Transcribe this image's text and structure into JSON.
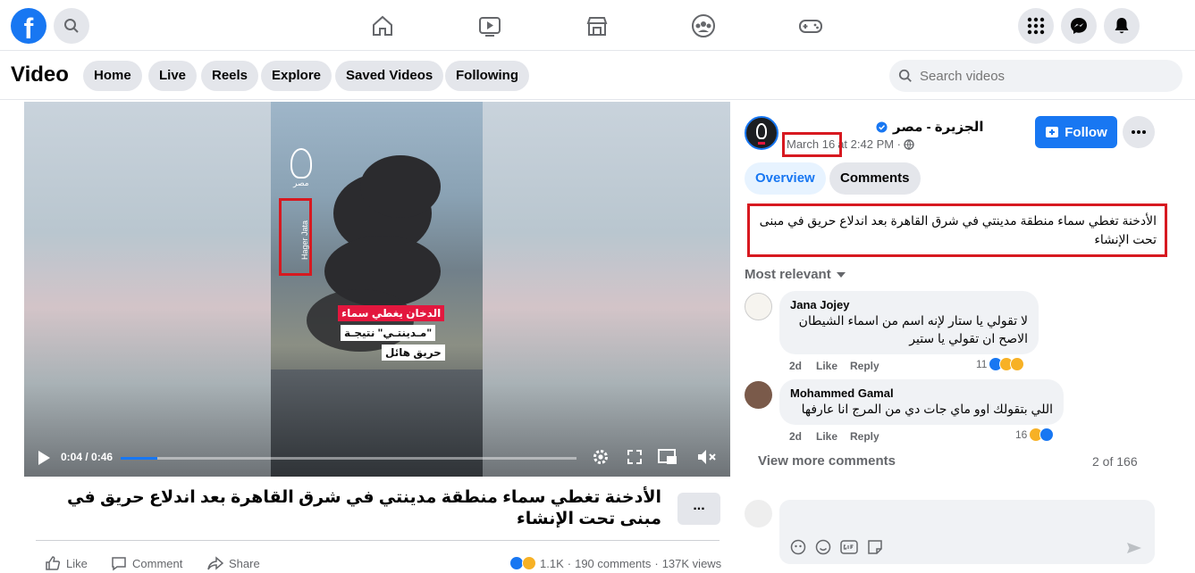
{
  "topbar": {
    "logo": "f",
    "nav_icons": [
      "home-icon",
      "video-icon",
      "marketplace-icon",
      "groups-icon",
      "gaming-icon"
    ],
    "right_icons": [
      "menu-grid-icon",
      "messenger-icon",
      "notifications-icon"
    ]
  },
  "subbar": {
    "title": "Video",
    "tabs": [
      "Home",
      "Live",
      "Reels",
      "Explore",
      "Saved Videos",
      "Following"
    ],
    "search_placeholder": "Search videos"
  },
  "player": {
    "time": "0:04 / 0:46",
    "progress_fraction": 0.08,
    "overlay_captions": [
      "الدخان يغطي سماء",
      "\"مـدينتـي\" نتيجـة",
      "حريق هائل"
    ],
    "watermark": "Hager Jata",
    "channel_mark": "مصر"
  },
  "post": {
    "title": "الأدخنة تغطي سماء منطقة مدينتي في شرق القاهرة بعد اندلاع حريق في مبنى تحت الإنشاء",
    "more": "...",
    "actions": {
      "like": "Like",
      "comment": "Comment",
      "share": "Share"
    },
    "stats": {
      "reactions": "1.1K",
      "comments": "190 comments",
      "views": "137K views"
    }
  },
  "sidebar": {
    "page_name": "الجزيرة - مصر",
    "date": "March 16",
    "time": "at 2:42 PM ·",
    "follow_label": "Follow",
    "tabs": [
      "Overview",
      "Comments"
    ],
    "description": "الأدخنة تغطي سماء منطقة مدينتي في شرق القاهرة بعد اندلاع حريق في مبنى تحت الإنشاء",
    "sort_label": "Most relevant",
    "comments": [
      {
        "name": "Jana Jojey",
        "text": "لا تقولي يا ستار لإنه اسم من اسماء الشيطان الاصح ان تقولي يا ستير",
        "age": "2d",
        "like": "Like",
        "reply": "Reply",
        "reactions": "11"
      },
      {
        "name": "Mohammed Gamal",
        "text": "اللي بتقولك اوو ماي جات دي من المرج انا عارفها",
        "age": "2d",
        "like": "Like",
        "reply": "Reply",
        "reactions": "16"
      }
    ],
    "view_more": "View more comments",
    "count": "2 of 166"
  },
  "colors": {
    "brand": "#1877f2",
    "highlight": "#d71920"
  }
}
